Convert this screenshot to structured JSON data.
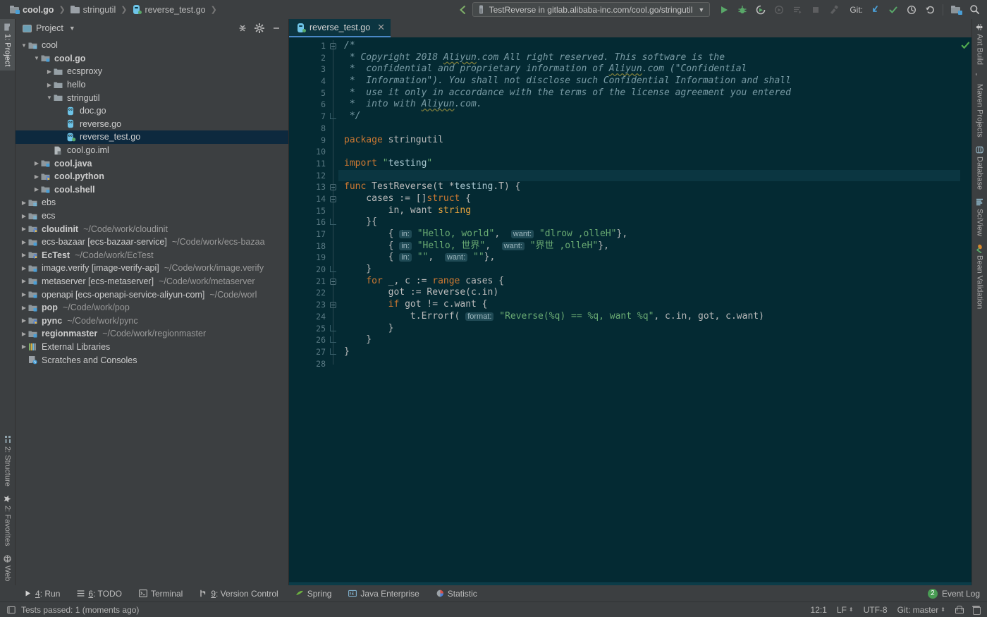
{
  "breadcrumbs": [
    {
      "label": "cool.go",
      "icon": "folder-module-icon",
      "bold": true
    },
    {
      "label": "stringutil",
      "icon": "folder-icon",
      "bold": false
    },
    {
      "label": "reverse_test.go",
      "icon": "go-test-file-icon",
      "bold": false
    }
  ],
  "toolbar": {
    "back_icon": "back-arrow-icon",
    "run_config": "TestReverse in gitlab.alibaba-inc.com/cool.go/stringutil",
    "run_config_icon": "test-flask-icon",
    "dropdown_icon": "chevron-down-icon",
    "run_icon": "run-icon",
    "debug_icon": "debug-icon",
    "coverage_icon": "run-with-coverage-icon",
    "profile_icon": "profile-icon",
    "rerun_tests_icon": "rerun-tests-icon",
    "stop_icon": "stop-icon",
    "hammer_icon": "build-icon",
    "git_label": "Git:",
    "git_update_icon": "update-project-icon",
    "git_commit_icon": "commit-icon",
    "git_history_icon": "history-icon",
    "git_rollback_icon": "rollback-icon",
    "search_everywhere_icon": "search-icon",
    "settings_icon": "gear-icon"
  },
  "left_rail": {
    "top": [
      {
        "label": "1: Project",
        "icon": "project-icon",
        "active": true
      }
    ],
    "bottom": [
      {
        "label": "2: Structure",
        "icon": "structure-icon",
        "active": false
      },
      {
        "label": "2: Favorites",
        "icon": "star-icon",
        "active": false
      },
      {
        "label": "Web",
        "icon": "web-icon",
        "active": false
      }
    ]
  },
  "right_rail": [
    {
      "label": "Ant Build",
      "icon": "ant-icon"
    },
    {
      "label": "Maven Projects",
      "icon": "maven-icon"
    },
    {
      "label": "Database",
      "icon": "database-icon"
    },
    {
      "label": "SciView",
      "icon": "sciview-icon"
    },
    {
      "label": "Bean Validation",
      "icon": "bean-validation-icon"
    }
  ],
  "project_panel": {
    "title": "Project",
    "caret_icon": "chevron-down-icon",
    "actions": [
      {
        "name": "collapse-all-icon"
      },
      {
        "name": "gear-icon"
      },
      {
        "name": "hide-icon"
      }
    ],
    "tree": [
      {
        "indent": 0,
        "tri": "open",
        "icon": "folder-module-grid-icon",
        "label": "cool",
        "bold": false,
        "path": "",
        "selected": false
      },
      {
        "indent": 1,
        "tri": "open",
        "icon": "folder-module-icon",
        "label": "cool.go",
        "bold": true,
        "path": "",
        "selected": false
      },
      {
        "indent": 2,
        "tri": "closed",
        "icon": "folder-icon",
        "label": "ecsproxy",
        "bold": false,
        "path": "",
        "selected": false
      },
      {
        "indent": 2,
        "tri": "closed",
        "icon": "folder-icon",
        "label": "hello",
        "bold": false,
        "path": "",
        "selected": false
      },
      {
        "indent": 2,
        "tri": "open",
        "icon": "folder-icon",
        "label": "stringutil",
        "bold": false,
        "path": "",
        "selected": false
      },
      {
        "indent": 3,
        "tri": "none",
        "icon": "go-file-icon",
        "label": "doc.go",
        "bold": false,
        "path": "",
        "selected": false
      },
      {
        "indent": 3,
        "tri": "none",
        "icon": "go-file-icon",
        "label": "reverse.go",
        "bold": false,
        "path": "",
        "selected": false
      },
      {
        "indent": 3,
        "tri": "none",
        "icon": "go-test-file-icon",
        "label": "reverse_test.go",
        "bold": false,
        "path": "",
        "selected": true
      },
      {
        "indent": 2,
        "tri": "none",
        "icon": "iml-file-icon",
        "label": "cool.go.iml",
        "bold": false,
        "path": "",
        "selected": false
      },
      {
        "indent": 1,
        "tri": "closed",
        "icon": "folder-module-icon",
        "label": "cool.java",
        "bold": true,
        "path": "",
        "selected": false
      },
      {
        "indent": 1,
        "tri": "closed",
        "icon": "folder-python-icon",
        "label": "cool.python",
        "bold": true,
        "path": "",
        "selected": false
      },
      {
        "indent": 1,
        "tri": "closed",
        "icon": "folder-module-icon",
        "label": "cool.shell",
        "bold": true,
        "path": "",
        "selected": false
      },
      {
        "indent": 0,
        "tri": "closed",
        "icon": "folder-module-grid-icon",
        "label": "ebs",
        "bold": false,
        "path": "",
        "selected": false
      },
      {
        "indent": 0,
        "tri": "closed",
        "icon": "folder-module-grid-icon",
        "label": "ecs",
        "bold": false,
        "path": "",
        "selected": false
      },
      {
        "indent": 0,
        "tri": "closed",
        "icon": "folder-python-icon",
        "label": "cloudinit",
        "bold": true,
        "path": "~/Code/work/cloudinit",
        "selected": false
      },
      {
        "indent": 0,
        "tri": "closed",
        "icon": "folder-module-icon",
        "label": "ecs-bazaar [ecs-bazaar-service]",
        "bold": false,
        "path": "~/Code/work/ecs-bazaa",
        "selected": false
      },
      {
        "indent": 0,
        "tri": "closed",
        "icon": "folder-python-icon",
        "label": "EcTest",
        "bold": true,
        "path": "~/Code/work/EcTest",
        "selected": false
      },
      {
        "indent": 0,
        "tri": "closed",
        "icon": "folder-module-icon",
        "label": "image.verify [image-verify-api]",
        "bold": false,
        "path": "~/Code/work/image.verify",
        "selected": false
      },
      {
        "indent": 0,
        "tri": "closed",
        "icon": "folder-module-icon",
        "label": "metaserver [ecs-metaserver]",
        "bold": false,
        "path": "~/Code/work/metaserver",
        "selected": false
      },
      {
        "indent": 0,
        "tri": "closed",
        "icon": "folder-module-icon",
        "label": "openapi [ecs-openapi-service-aliyun-com]",
        "bold": false,
        "path": "~/Code/worl",
        "selected": false
      },
      {
        "indent": 0,
        "tri": "closed",
        "icon": "folder-module-icon",
        "label": "pop",
        "bold": true,
        "path": "~/Code/work/pop",
        "selected": false
      },
      {
        "indent": 0,
        "tri": "closed",
        "icon": "folder-python-icon",
        "label": "pync",
        "bold": true,
        "path": "~/Code/work/pync",
        "selected": false
      },
      {
        "indent": 0,
        "tri": "closed",
        "icon": "folder-module-icon",
        "label": "regionmaster",
        "bold": true,
        "path": "~/Code/work/regionmaster",
        "selected": false
      },
      {
        "indent": 0,
        "tri": "closed",
        "icon": "external-libraries-icon",
        "label": "External Libraries",
        "bold": false,
        "path": "",
        "selected": false
      },
      {
        "indent": 0,
        "tri": "none",
        "icon": "scratches-icon",
        "label": "Scratches and Consoles",
        "bold": false,
        "path": "",
        "selected": false
      }
    ]
  },
  "editor": {
    "tab": {
      "label": "reverse_test.go",
      "icon": "go-test-file-icon",
      "close_icon": "close-icon"
    },
    "inspection_status_icon": "inspection-ok-icon",
    "current_line": 12,
    "total_lines": 28,
    "run_gutter_line": 9,
    "run_gutter_line2": 13,
    "lines": [
      {
        "n": 1,
        "fold": "start",
        "text": "/*"
      },
      {
        "n": 2,
        "fold": "",
        "text": " * Copyright 2018 Aliyun.com All right reserved. This software is the"
      },
      {
        "n": 3,
        "fold": "",
        "text": " *  confidential and proprietary information of Aliyun.com (\"Confidential"
      },
      {
        "n": 4,
        "fold": "",
        "text": " *  Information\"). You shall not disclose such Confidential Information and shall"
      },
      {
        "n": 5,
        "fold": "",
        "text": " *  use it only in accordance with the terms of the license agreement you entered"
      },
      {
        "n": 6,
        "fold": "",
        "text": " *  into with Aliyun.com."
      },
      {
        "n": 7,
        "fold": "end",
        "text": " */"
      },
      {
        "n": 8,
        "fold": "",
        "text": ""
      },
      {
        "n": 9,
        "fold": "",
        "text": "package stringutil"
      },
      {
        "n": 10,
        "fold": "",
        "text": ""
      },
      {
        "n": 11,
        "fold": "",
        "text": "import \"testing\""
      },
      {
        "n": 12,
        "fold": "",
        "text": ""
      },
      {
        "n": 13,
        "fold": "start",
        "text": "func TestReverse(t *testing.T) {"
      },
      {
        "n": 14,
        "fold": "start",
        "text": "    cases := []struct {"
      },
      {
        "n": 15,
        "fold": "",
        "text": "        in, want string"
      },
      {
        "n": 16,
        "fold": "end",
        "text": "    }{"
      },
      {
        "n": 17,
        "fold": "",
        "text": "        { in: \"Hello, world\",  want: \"dlrow ,olleH\"},"
      },
      {
        "n": 18,
        "fold": "",
        "text": "        { in: \"Hello, 世界\",  want: \"界世 ,olleH\"},"
      },
      {
        "n": 19,
        "fold": "",
        "text": "        { in: \"\",  want: \"\"},"
      },
      {
        "n": 20,
        "fold": "end",
        "text": "    }"
      },
      {
        "n": 21,
        "fold": "start",
        "text": "    for _, c := range cases {"
      },
      {
        "n": 22,
        "fold": "",
        "text": "        got := Reverse(c.in)"
      },
      {
        "n": 23,
        "fold": "start",
        "text": "        if got != c.want {"
      },
      {
        "n": 24,
        "fold": "",
        "text": "            t.Errorf( format: \"Reverse(%q) == %q, want %q\", c.in, got, c.want)"
      },
      {
        "n": 25,
        "fold": "end",
        "text": "        }"
      },
      {
        "n": 26,
        "fold": "end",
        "text": "    }"
      },
      {
        "n": 27,
        "fold": "end",
        "text": "}"
      },
      {
        "n": 28,
        "fold": "",
        "text": ""
      }
    ]
  },
  "tool_windows": [
    {
      "label_prefix": "",
      "mnemonic": "4",
      "label": ": Run",
      "icon": "run-icon"
    },
    {
      "label_prefix": "",
      "mnemonic": "6",
      "label": ": TODO",
      "icon": "todo-icon"
    },
    {
      "label_prefix": "",
      "mnemonic": "",
      "label": "Terminal",
      "icon": "terminal-icon"
    },
    {
      "label_prefix": "",
      "mnemonic": "9",
      "label": ": Version Control",
      "icon": "vcs-icon"
    },
    {
      "label_prefix": "",
      "mnemonic": "",
      "label": "Spring",
      "icon": "spring-icon"
    },
    {
      "label_prefix": "",
      "mnemonic": "",
      "label": "Java Enterprise",
      "icon": "java-enterprise-icon"
    },
    {
      "label_prefix": "",
      "mnemonic": "",
      "label": "Statistic",
      "icon": "statistic-icon"
    }
  ],
  "event_log": {
    "count": "2",
    "label": "Event Log"
  },
  "status_bar": {
    "message_icon": "message-icon",
    "message": "Tests passed: 1 (moments ago)",
    "caret_position": "12:1",
    "line_separator": "LF",
    "encoding": "UTF-8",
    "git_branch": "Git: master",
    "lock_icon": "unlocked-icon",
    "trash_icon": "trash-icon"
  },
  "colors": {
    "chrome_bg": "#3C3F41",
    "editor_bg": "#042A33",
    "selection_bg": "#0D293E",
    "tab_active_bg": "#0C3541",
    "tab_underline": "#4A88C7",
    "accent_green": "#59A869",
    "keyword": "#CC7832",
    "string": "#6AAB73",
    "comment": "#7A9CA6",
    "type": "#E8A33D",
    "hint_bg": "#1F4A55"
  }
}
